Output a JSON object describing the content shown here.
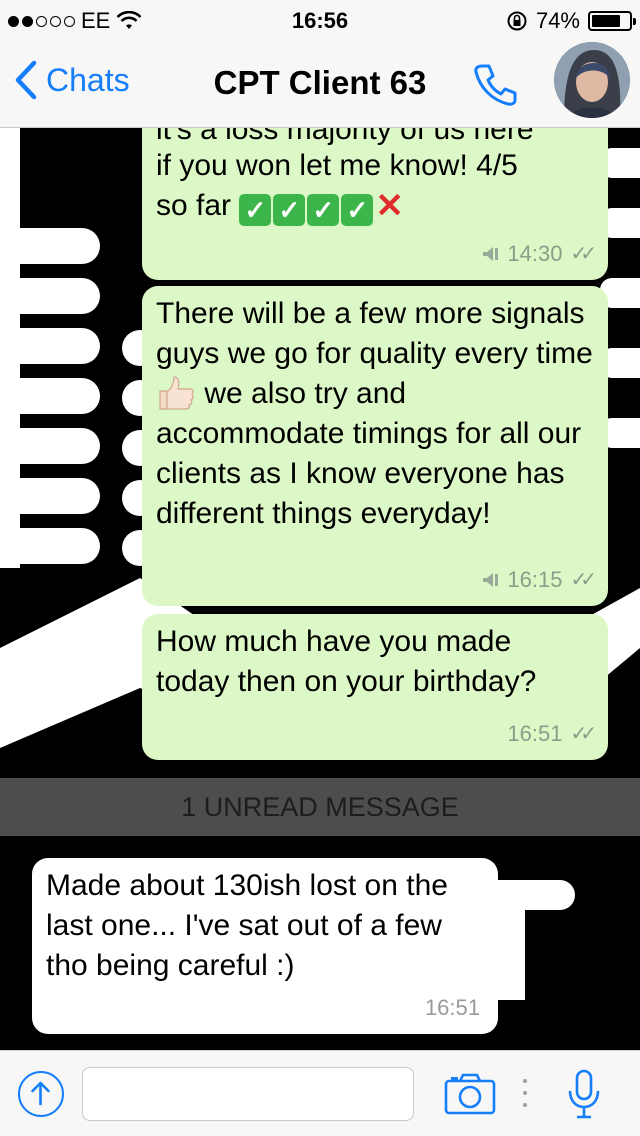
{
  "status_bar": {
    "carrier": "EE",
    "time": "16:56",
    "battery": "74%"
  },
  "nav": {
    "back_label": "Chats",
    "title": "CPT Client 63"
  },
  "messages": [
    {
      "direction": "outgoing",
      "partial_top_text": "it's a loss majority of us here",
      "text_line1": "if you won let me know! 4/5",
      "text_line2": "so far",
      "emoji": [
        "check-mark-button",
        "check-mark-button",
        "check-mark-button",
        "check-mark-button",
        "cross-mark"
      ],
      "time": "14:30",
      "status": "read"
    },
    {
      "direction": "outgoing",
      "text_before_emoji": "There will be a few more signals guys we go for quality every time",
      "emoji": "thumbs-up",
      "text_after_emoji": "we also try and accommodate timings for all our clients as I know everyone has different things everyday!",
      "time": "16:15",
      "status": "read"
    },
    {
      "direction": "outgoing",
      "text": "How much have you made today then on your birthday?",
      "time": "16:51",
      "status": "read"
    },
    {
      "direction": "incoming",
      "text": "Made about 130ish lost on the last one... I've sat out of a few tho being careful :)",
      "time": "16:51"
    }
  ],
  "unread_banner": "1 UNREAD MESSAGE",
  "composer": {
    "placeholder": ""
  },
  "colors": {
    "accent": "#157efb",
    "outgoing_bubble": "#dcf8c6",
    "incoming_bubble": "#ffffff"
  }
}
